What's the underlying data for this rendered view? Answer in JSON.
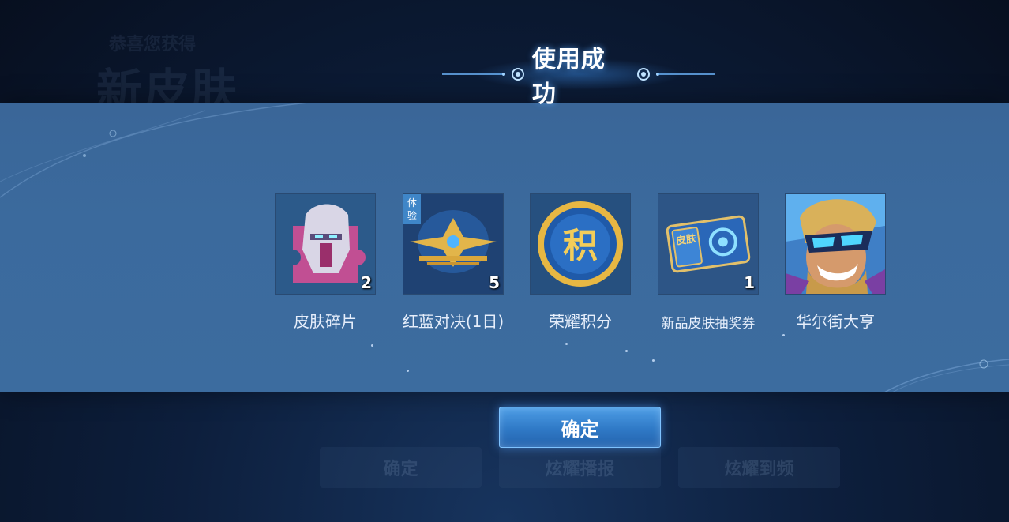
{
  "background": {
    "ghost_subtitle": "恭喜您获得",
    "ghost_title": "新皮肤",
    "ghost_buttons": [
      "确定",
      "炫耀播报",
      "炫耀到频"
    ]
  },
  "dialog": {
    "title": "使用成功",
    "confirm_label": "确定"
  },
  "items": [
    {
      "name": "皮肤碎片",
      "count": "2",
      "icon": "skin-fragment-icon"
    },
    {
      "name": "红蓝对决(1日)",
      "count": "5",
      "badge": "体验",
      "icon": "red-blue-duel-icon"
    },
    {
      "name": "荣耀积分",
      "count": "",
      "icon_text": "积",
      "icon": "honor-points-icon"
    },
    {
      "name": "新品皮肤抽奖券",
      "count": "1",
      "icon_text": "皮肤",
      "icon": "skin-lottery-ticket-icon"
    },
    {
      "name": "华尔街大亨",
      "count": "",
      "icon": "hero-skin-portrait-icon"
    }
  ],
  "colors": {
    "panel": "#3b6a9d",
    "accent": "#4e9ee6",
    "title_glow": "#5aaaff"
  }
}
